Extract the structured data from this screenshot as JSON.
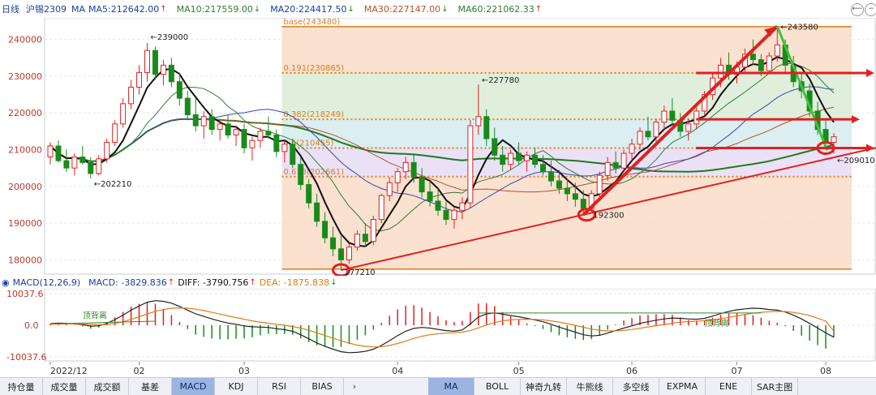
{
  "header": {
    "period": "日线",
    "symbol": "沪锡2309",
    "ma": [
      {
        "label": "MA",
        "name": "MA5",
        "value": "212642.00",
        "dir": "up",
        "color": "#1a3fa0"
      },
      {
        "name": "MA10",
        "value": "217559.00",
        "dir": "down",
        "color": "#2e7d32"
      },
      {
        "name": "MA20",
        "value": "224417.50",
        "dir": "down",
        "color": "#1a3fa0"
      },
      {
        "name": "MA30",
        "value": "227147.00",
        "dir": "down",
        "color": "#b5522a"
      },
      {
        "name": "MA60",
        "value": "221062.33",
        "dir": "up",
        "color": "#2e7d32"
      }
    ]
  },
  "macd_header": {
    "label": "MACD(12,26,9)",
    "macd": "MACD: -3829.836",
    "diff": "DIFF: -3790.756",
    "dea": "DEA: -1875.838",
    "macd_dir": "up",
    "dea_dir": "down"
  },
  "tabs_left": [
    "持仓量",
    "成交量",
    "成交额",
    "基差",
    "MACD",
    "KDJ",
    "RSI",
    "BIAS"
  ],
  "tabs_left_active": "MACD",
  "tabs_more": "›",
  "tabs_right": [
    "MA",
    "BOLL",
    "神奇九转",
    "牛熊线",
    "多空线",
    "EXPMA",
    "ENE",
    "SAR主图"
  ],
  "tabs_right_active": "MA",
  "icons": {
    "back": "back-icon",
    "minus": "minus-icon"
  },
  "colors": {
    "up": "#e02020",
    "down": "#1a8a1a",
    "ma5": "#111111",
    "ma10": "#2e7d32",
    "ma20": "#3848b0",
    "ma30": "#b5522a",
    "ma60": "#1f7a1f"
  },
  "chart_data": [
    {
      "type": "candlestick",
      "title": "沪锡2309 日线",
      "ylim": [
        177000,
        245000
      ],
      "yticks": [
        "240000",
        "230000",
        "220000",
        "210000",
        "200000",
        "190000",
        "180000"
      ],
      "ytick_values": [
        240000,
        230000,
        220000,
        210000,
        200000,
        190000,
        180000
      ],
      "xticks": [
        "2022/12",
        "02",
        "03",
        "04",
        "05",
        "06",
        "07",
        "08"
      ],
      "fib_levels": [
        {
          "label": "base(243480)",
          "value": 243480
        },
        {
          "label": "0.191(230865)",
          "value": 230865
        },
        {
          "label": "0.382(218249)",
          "value": 218249
        },
        {
          "label": "0.5(210455)",
          "value": 210455
        },
        {
          "label": "0.618(202661)",
          "value": 202661
        }
      ],
      "annotations": [
        {
          "label": "←239000",
          "value": 239000
        },
        {
          "label": "←202210",
          "value": 202210
        },
        {
          "label": "←227780",
          "value": 227780
        },
        {
          "label": "←243580",
          "value": 243580
        },
        {
          "label": "192300",
          "value": 192300
        },
        {
          "label": "←209010",
          "value": 209010
        },
        {
          "label": "177210",
          "value": 177210
        }
      ],
      "ohlc": [
        [
          208000,
          212000,
          206000,
          211000
        ],
        [
          211000,
          212500,
          206500,
          207000
        ],
        [
          207000,
          210000,
          204000,
          205000
        ],
        [
          205000,
          209000,
          203000,
          208000
        ],
        [
          208000,
          211000,
          206000,
          206500
        ],
        [
          206500,
          208000,
          202210,
          203500
        ],
        [
          203500,
          208500,
          203000,
          207500
        ],
        [
          207500,
          213000,
          206500,
          212000
        ],
        [
          212000,
          218000,
          211000,
          217000
        ],
        [
          217000,
          224000,
          216000,
          222500
        ],
        [
          222500,
          229000,
          221000,
          227000
        ],
        [
          227000,
          233000,
          225000,
          231000
        ],
        [
          231000,
          239000,
          228500,
          237000
        ],
        [
          237000,
          238000,
          229000,
          230500
        ],
        [
          230500,
          234500,
          227500,
          233000
        ],
        [
          233000,
          235000,
          227000,
          228500
        ],
        [
          228500,
          231000,
          222000,
          224000
        ],
        [
          224000,
          226000,
          218000,
          219500
        ],
        [
          219500,
          224000,
          215000,
          216500
        ],
        [
          216500,
          220500,
          213000,
          219000
        ],
        [
          219000,
          221000,
          214000,
          215500
        ],
        [
          215500,
          218000,
          212500,
          217000
        ],
        [
          217000,
          219500,
          213000,
          214000
        ],
        [
          214000,
          216500,
          211000,
          215500
        ],
        [
          215500,
          217000,
          209000,
          210500
        ],
        [
          210500,
          213500,
          207000,
          212500
        ],
        [
          212500,
          216000,
          210500,
          215000
        ],
        [
          215000,
          219000,
          213000,
          214000
        ],
        [
          214000,
          215500,
          208000,
          209500
        ],
        [
          209500,
          212500,
          206500,
          211500
        ],
        [
          211500,
          213000,
          205000,
          206000
        ],
        [
          206000,
          208000,
          199000,
          200500
        ],
        [
          200500,
          202000,
          194000,
          195500
        ],
        [
          195500,
          198000,
          189000,
          190500
        ],
        [
          190500,
          193000,
          184500,
          186000
        ],
        [
          186000,
          189000,
          181000,
          183000
        ],
        [
          183000,
          186500,
          177210,
          180000
        ],
        [
          180000,
          184500,
          179000,
          183500
        ],
        [
          183500,
          188000,
          182500,
          187000
        ],
        [
          187000,
          190000,
          183500,
          185000
        ],
        [
          185000,
          192000,
          184000,
          191000
        ],
        [
          191000,
          198000,
          190000,
          197500
        ],
        [
          197500,
          202500,
          196000,
          201000
        ],
        [
          201000,
          205000,
          198500,
          204000
        ],
        [
          204000,
          208000,
          202000,
          206500
        ],
        [
          206500,
          208500,
          201000,
          202500
        ],
        [
          202500,
          205000,
          197000,
          198500
        ],
        [
          198500,
          201500,
          194500,
          196000
        ],
        [
          196000,
          199500,
          192000,
          193500
        ],
        [
          193500,
          196000,
          189500,
          191000
        ],
        [
          191000,
          194500,
          188500,
          193500
        ],
        [
          193500,
          197000,
          191000,
          195500
        ],
        [
          195500,
          218000,
          194000,
          216500
        ],
        [
          216500,
          227780,
          214000,
          219000
        ],
        [
          219000,
          221000,
          211000,
          213000
        ],
        [
          213000,
          216000,
          207000,
          208500
        ],
        [
          208500,
          211000,
          204000,
          206000
        ],
        [
          206000,
          210000,
          204500,
          209000
        ],
        [
          209000,
          212000,
          206000,
          207000
        ],
        [
          207000,
          209500,
          204000,
          208500
        ],
        [
          208500,
          210500,
          205000,
          206000
        ],
        [
          206000,
          208500,
          203000,
          204000
        ],
        [
          204000,
          207000,
          200000,
          201500
        ],
        [
          201500,
          204500,
          198000,
          199500
        ],
        [
          199500,
          202000,
          196000,
          198000
        ],
        [
          198000,
          201000,
          194500,
          196500
        ],
        [
          196500,
          199000,
          192300,
          194000
        ],
        [
          194000,
          199000,
          193500,
          198000
        ],
        [
          198000,
          204000,
          197000,
          203000
        ],
        [
          203000,
          208000,
          201500,
          206500
        ],
        [
          206500,
          209500,
          203500,
          205000
        ],
        [
          205000,
          210000,
          204000,
          209000
        ],
        [
          209000,
          213000,
          207000,
          211500
        ],
        [
          211500,
          216000,
          210000,
          215000
        ],
        [
          215000,
          219000,
          212500,
          213500
        ],
        [
          213500,
          218500,
          212000,
          217500
        ],
        [
          217500,
          222000,
          215500,
          220500
        ],
        [
          220500,
          224000,
          216500,
          218000
        ],
        [
          218000,
          220000,
          213500,
          215000
        ],
        [
          215000,
          218500,
          212500,
          217000
        ],
        [
          217000,
          221500,
          215500,
          220500
        ],
        [
          220500,
          226000,
          219500,
          225000
        ],
        [
          225000,
          231000,
          223500,
          229500
        ],
        [
          229500,
          235000,
          227000,
          233000
        ],
        [
          233000,
          236500,
          229000,
          230500
        ],
        [
          230500,
          234000,
          228000,
          232500
        ],
        [
          232500,
          237500,
          231000,
          236000
        ],
        [
          236000,
          240000,
          233000,
          234500
        ],
        [
          234500,
          236000,
          230000,
          231500
        ],
        [
          231500,
          236500,
          230500,
          235500
        ],
        [
          235500,
          243580,
          234000,
          238500
        ],
        [
          238500,
          240000,
          231000,
          233000
        ],
        [
          233000,
          235500,
          227000,
          228500
        ],
        [
          228500,
          231000,
          224000,
          226000
        ],
        [
          226000,
          228000,
          219000,
          220500
        ],
        [
          220500,
          223000,
          214000,
          215500
        ],
        [
          215500,
          218000,
          210500,
          212000
        ],
        [
          212000,
          214500,
          209010,
          213500
        ]
      ]
    },
    {
      "type": "macd",
      "params": "12,26,9",
      "ylim": [
        -10037.6,
        10037.6
      ],
      "yticks": [
        "10037.6",
        "0.0",
        "-10037.6"
      ],
      "ytick_values": [
        10037.6,
        0,
        -10037.6
      ],
      "annotations": [
        "顶背离",
        "顶背离"
      ],
      "diff": [
        500,
        700,
        600,
        400,
        200,
        -300,
        -200,
        600,
        1800,
        3200,
        4800,
        6100,
        7300,
        7800,
        7600,
        7000,
        6000,
        4800,
        3600,
        2800,
        2000,
        1300,
        700,
        300,
        -200,
        -500,
        -600,
        -700,
        -1100,
        -1400,
        -1900,
        -3000,
        -4300,
        -5600,
        -6700,
        -7600,
        -8400,
        -8700,
        -8600,
        -8300,
        -7600,
        -6400,
        -4900,
        -3300,
        -1900,
        -1000,
        -700,
        -900,
        -1300,
        -1700,
        -1900,
        -1500,
        400,
        2600,
        3600,
        3900,
        3500,
        3100,
        2700,
        2200,
        1700,
        1100,
        300,
        -600,
        -1400,
        -2200,
        -3000,
        -3400,
        -3200,
        -2500,
        -1700,
        -900,
        -200,
        600,
        1100,
        1600,
        2000,
        2300,
        2200,
        2000,
        1900,
        2200,
        2900,
        3700,
        4400,
        4900,
        5200,
        5400,
        5300,
        5000,
        4800,
        4200,
        3200,
        2000,
        600,
        -900,
        -2400,
        -3790.756
      ],
      "dea": [
        300,
        400,
        450,
        450,
        400,
        250,
        150,
        250,
        550,
        1100,
        1850,
        2700,
        3600,
        4400,
        5000,
        5400,
        5500,
        5400,
        5100,
        4650,
        4100,
        3550,
        2950,
        2450,
        1900,
        1400,
        1000,
        650,
        300,
        0,
        -400,
        -900,
        -1600,
        -2400,
        -3250,
        -4100,
        -4950,
        -5700,
        -6300,
        -6700,
        -6900,
        -6800,
        -6400,
        -5800,
        -5000,
        -4200,
        -3500,
        -3000,
        -2700,
        -2500,
        -2400,
        -2200,
        -1700,
        -850,
        100,
        850,
        1400,
        1700,
        1850,
        1900,
        1850,
        1700,
        1400,
        1000,
        500,
        -50,
        -650,
        -1200,
        -1600,
        -1800,
        -1800,
        -1650,
        -1350,
        -950,
        -550,
        -150,
        250,
        650,
        950,
        1150,
        1300,
        1450,
        1700,
        2050,
        2500,
        2950,
        3400,
        3800,
        4100,
        4300,
        4400,
        4350,
        4100,
        3650,
        3050,
        2250,
        1300,
        -1875.838
      ]
    }
  ]
}
